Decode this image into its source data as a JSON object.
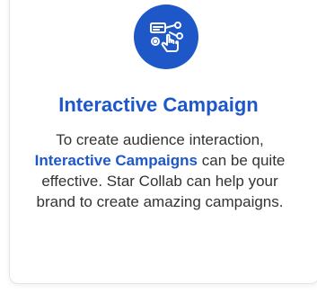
{
  "card": {
    "icon": "interactive-campaign-icon",
    "title": "Interactive Campaign",
    "description_intro": "To create audience interaction,",
    "description_highlight": "Interactive Campaigns",
    "description_rest": " can be quite effective. Star Collab can help your brand to create amazing campaigns."
  },
  "colors": {
    "accent": "#1e58c8",
    "text": "#333333",
    "card_border": "#e3e5e9"
  }
}
